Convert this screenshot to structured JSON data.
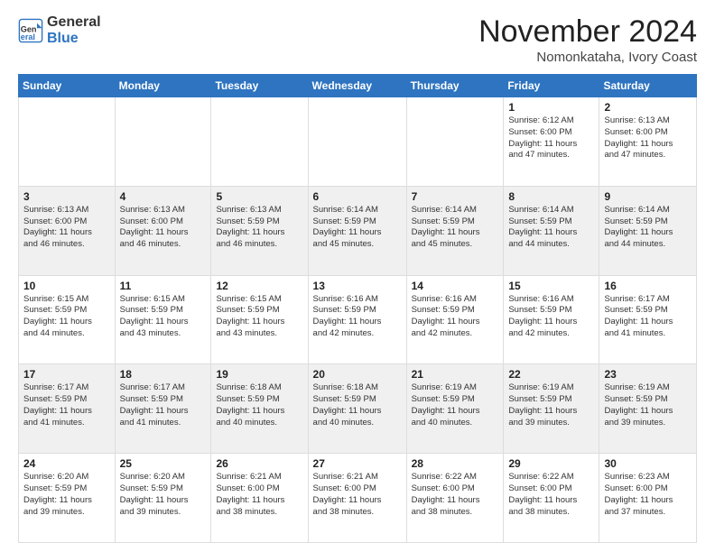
{
  "header": {
    "logo_line1": "General",
    "logo_line2": "Blue",
    "month": "November 2024",
    "location": "Nomonkataha, Ivory Coast"
  },
  "days_of_week": [
    "Sunday",
    "Monday",
    "Tuesday",
    "Wednesday",
    "Thursday",
    "Friday",
    "Saturday"
  ],
  "weeks": [
    [
      {
        "day": "",
        "info": ""
      },
      {
        "day": "",
        "info": ""
      },
      {
        "day": "",
        "info": ""
      },
      {
        "day": "",
        "info": ""
      },
      {
        "day": "",
        "info": ""
      },
      {
        "day": "1",
        "info": "Sunrise: 6:12 AM\nSunset: 6:00 PM\nDaylight: 11 hours\nand 47 minutes."
      },
      {
        "day": "2",
        "info": "Sunrise: 6:13 AM\nSunset: 6:00 PM\nDaylight: 11 hours\nand 47 minutes."
      }
    ],
    [
      {
        "day": "3",
        "info": "Sunrise: 6:13 AM\nSunset: 6:00 PM\nDaylight: 11 hours\nand 46 minutes."
      },
      {
        "day": "4",
        "info": "Sunrise: 6:13 AM\nSunset: 6:00 PM\nDaylight: 11 hours\nand 46 minutes."
      },
      {
        "day": "5",
        "info": "Sunrise: 6:13 AM\nSunset: 5:59 PM\nDaylight: 11 hours\nand 46 minutes."
      },
      {
        "day": "6",
        "info": "Sunrise: 6:14 AM\nSunset: 5:59 PM\nDaylight: 11 hours\nand 45 minutes."
      },
      {
        "day": "7",
        "info": "Sunrise: 6:14 AM\nSunset: 5:59 PM\nDaylight: 11 hours\nand 45 minutes."
      },
      {
        "day": "8",
        "info": "Sunrise: 6:14 AM\nSunset: 5:59 PM\nDaylight: 11 hours\nand 44 minutes."
      },
      {
        "day": "9",
        "info": "Sunrise: 6:14 AM\nSunset: 5:59 PM\nDaylight: 11 hours\nand 44 minutes."
      }
    ],
    [
      {
        "day": "10",
        "info": "Sunrise: 6:15 AM\nSunset: 5:59 PM\nDaylight: 11 hours\nand 44 minutes."
      },
      {
        "day": "11",
        "info": "Sunrise: 6:15 AM\nSunset: 5:59 PM\nDaylight: 11 hours\nand 43 minutes."
      },
      {
        "day": "12",
        "info": "Sunrise: 6:15 AM\nSunset: 5:59 PM\nDaylight: 11 hours\nand 43 minutes."
      },
      {
        "day": "13",
        "info": "Sunrise: 6:16 AM\nSunset: 5:59 PM\nDaylight: 11 hours\nand 42 minutes."
      },
      {
        "day": "14",
        "info": "Sunrise: 6:16 AM\nSunset: 5:59 PM\nDaylight: 11 hours\nand 42 minutes."
      },
      {
        "day": "15",
        "info": "Sunrise: 6:16 AM\nSunset: 5:59 PM\nDaylight: 11 hours\nand 42 minutes."
      },
      {
        "day": "16",
        "info": "Sunrise: 6:17 AM\nSunset: 5:59 PM\nDaylight: 11 hours\nand 41 minutes."
      }
    ],
    [
      {
        "day": "17",
        "info": "Sunrise: 6:17 AM\nSunset: 5:59 PM\nDaylight: 11 hours\nand 41 minutes."
      },
      {
        "day": "18",
        "info": "Sunrise: 6:17 AM\nSunset: 5:59 PM\nDaylight: 11 hours\nand 41 minutes."
      },
      {
        "day": "19",
        "info": "Sunrise: 6:18 AM\nSunset: 5:59 PM\nDaylight: 11 hours\nand 40 minutes."
      },
      {
        "day": "20",
        "info": "Sunrise: 6:18 AM\nSunset: 5:59 PM\nDaylight: 11 hours\nand 40 minutes."
      },
      {
        "day": "21",
        "info": "Sunrise: 6:19 AM\nSunset: 5:59 PM\nDaylight: 11 hours\nand 40 minutes."
      },
      {
        "day": "22",
        "info": "Sunrise: 6:19 AM\nSunset: 5:59 PM\nDaylight: 11 hours\nand 39 minutes."
      },
      {
        "day": "23",
        "info": "Sunrise: 6:19 AM\nSunset: 5:59 PM\nDaylight: 11 hours\nand 39 minutes."
      }
    ],
    [
      {
        "day": "24",
        "info": "Sunrise: 6:20 AM\nSunset: 5:59 PM\nDaylight: 11 hours\nand 39 minutes."
      },
      {
        "day": "25",
        "info": "Sunrise: 6:20 AM\nSunset: 5:59 PM\nDaylight: 11 hours\nand 39 minutes."
      },
      {
        "day": "26",
        "info": "Sunrise: 6:21 AM\nSunset: 6:00 PM\nDaylight: 11 hours\nand 38 minutes."
      },
      {
        "day": "27",
        "info": "Sunrise: 6:21 AM\nSunset: 6:00 PM\nDaylight: 11 hours\nand 38 minutes."
      },
      {
        "day": "28",
        "info": "Sunrise: 6:22 AM\nSunset: 6:00 PM\nDaylight: 11 hours\nand 38 minutes."
      },
      {
        "day": "29",
        "info": "Sunrise: 6:22 AM\nSunset: 6:00 PM\nDaylight: 11 hours\nand 38 minutes."
      },
      {
        "day": "30",
        "info": "Sunrise: 6:23 AM\nSunset: 6:00 PM\nDaylight: 11 hours\nand 37 minutes."
      }
    ]
  ]
}
